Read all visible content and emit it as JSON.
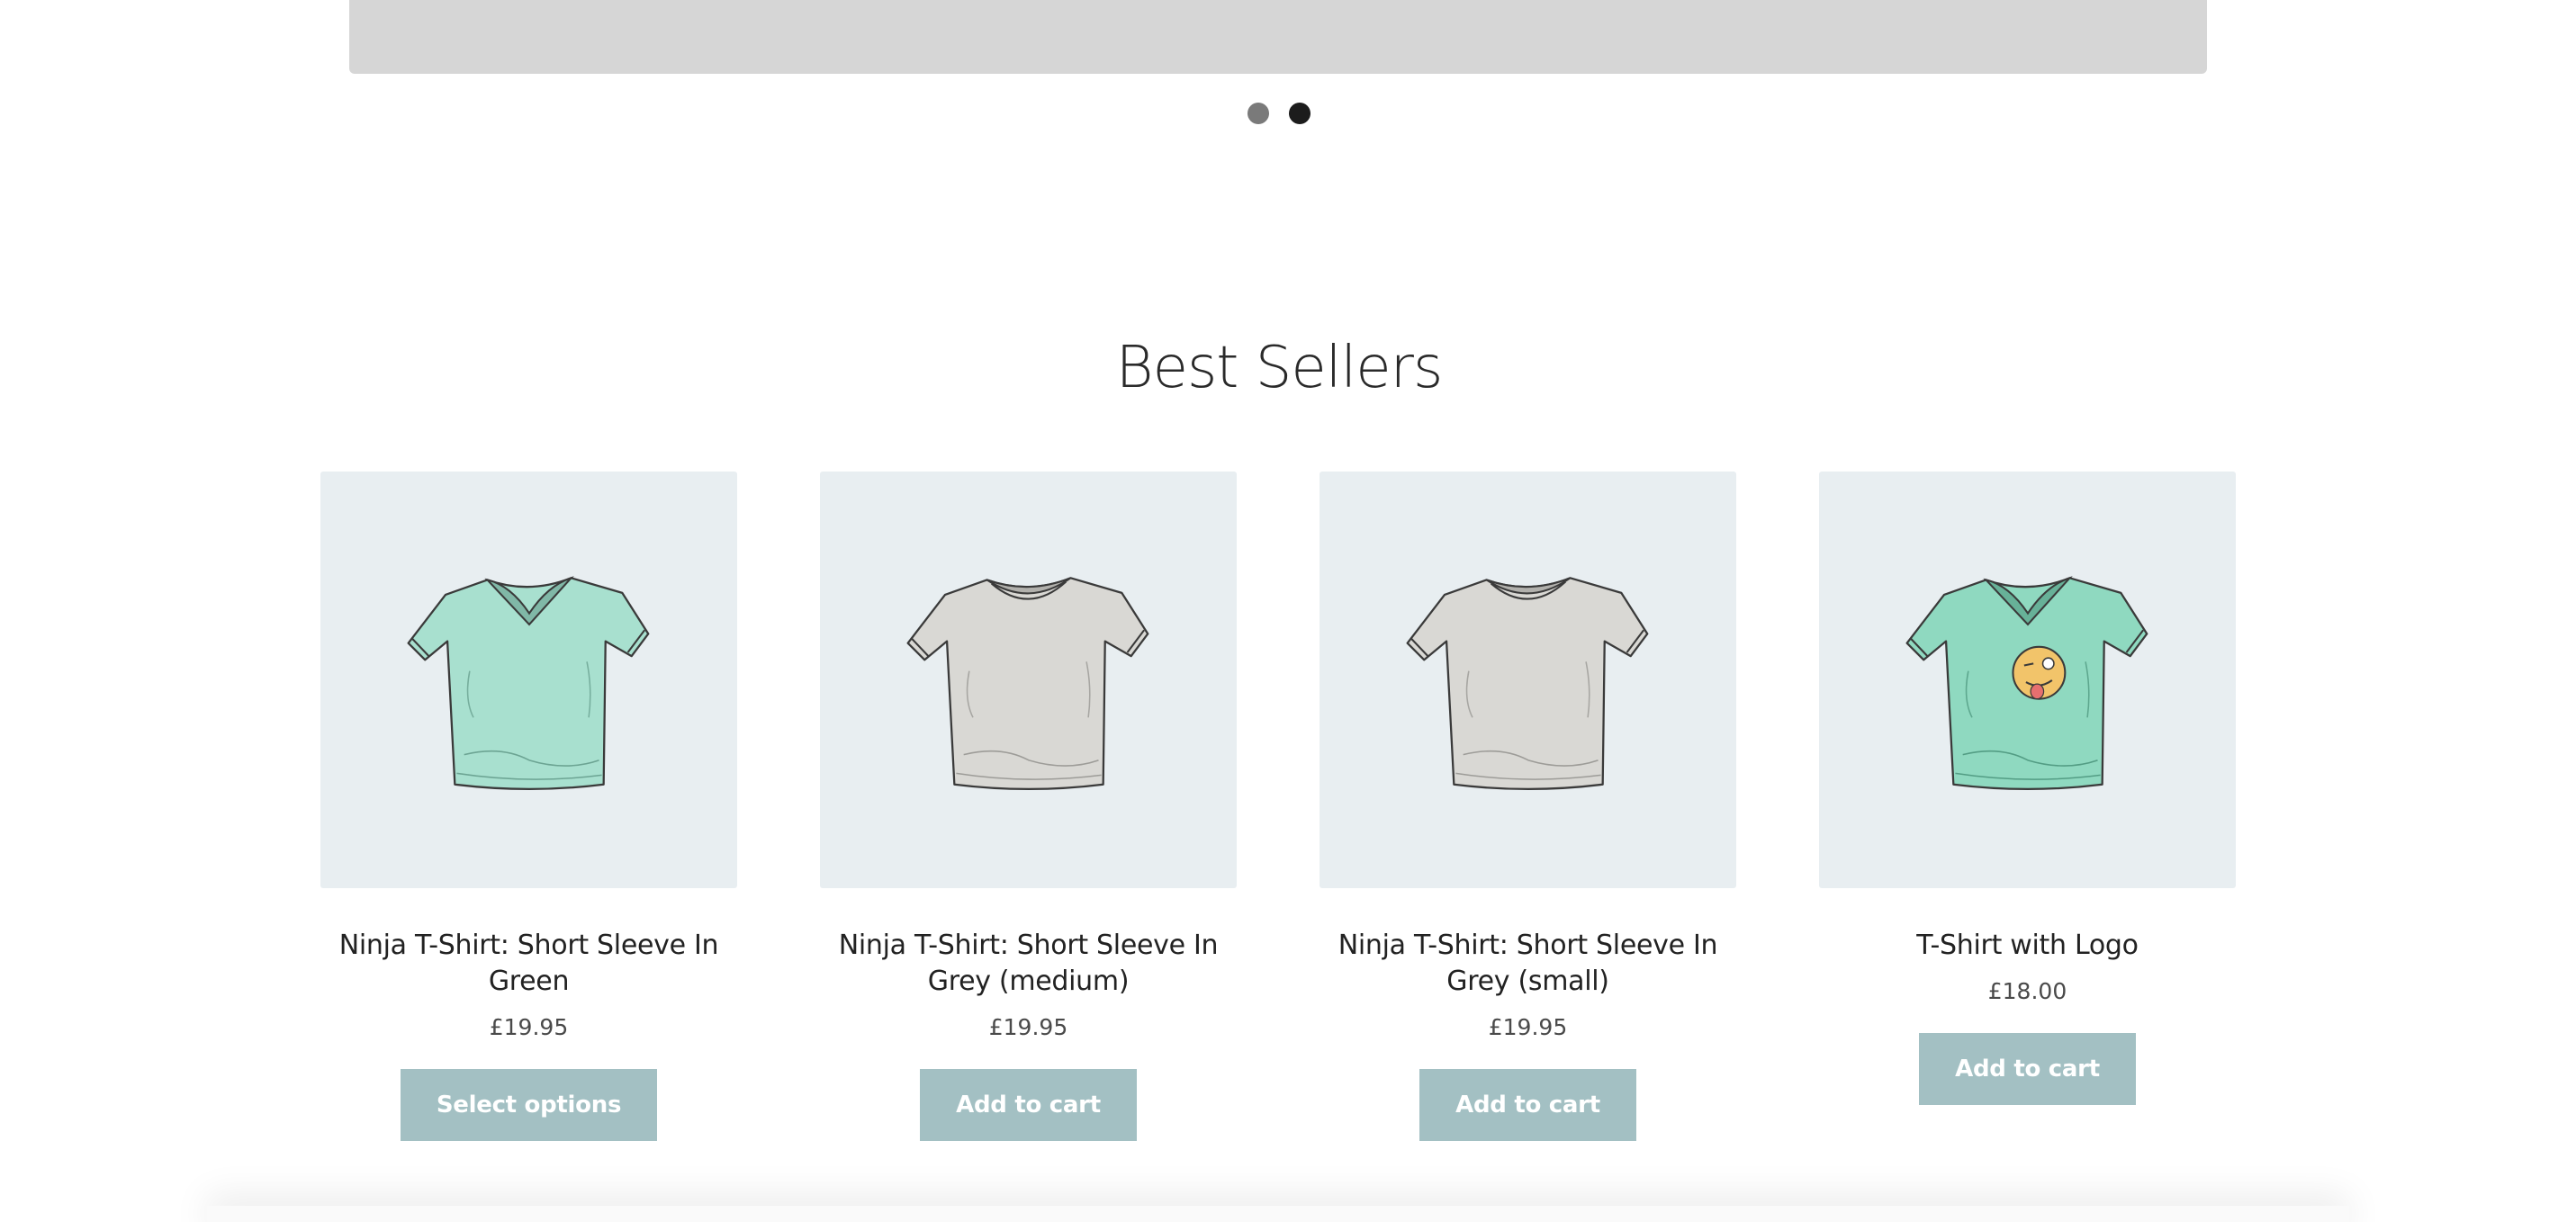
{
  "slider": {
    "dots": [
      {
        "state": "inactive"
      },
      {
        "state": "active"
      }
    ]
  },
  "best_sellers": {
    "title": "Best Sellers",
    "products": [
      {
        "name": "Ninja T-Shirt: Short Sleeve In Green",
        "price": "£19.95",
        "button": "Select options",
        "shirt_color": "#a8e0cf",
        "neck": "v",
        "logo": false
      },
      {
        "name": "Ninja T-Shirt: Short Sleeve In Grey (medium)",
        "price": "£19.95",
        "button": "Add to cart",
        "shirt_color": "#d9d8d4",
        "neck": "crew",
        "logo": false
      },
      {
        "name": "Ninja T-Shirt: Short Sleeve In Grey (small)",
        "price": "£19.95",
        "button": "Add to cart",
        "shirt_color": "#d9d8d4",
        "neck": "crew",
        "logo": false
      },
      {
        "name": "T-Shirt with Logo",
        "price": "£18.00",
        "button": "Add to cart",
        "shirt_color": "#8fd9c0",
        "neck": "v",
        "logo": true
      }
    ]
  },
  "colors": {
    "button_bg": "#a3c0c3",
    "image_bg": "#e8eef1",
    "dot_active": "#1c1c1c",
    "dot_inactive": "#7a7a7a"
  }
}
